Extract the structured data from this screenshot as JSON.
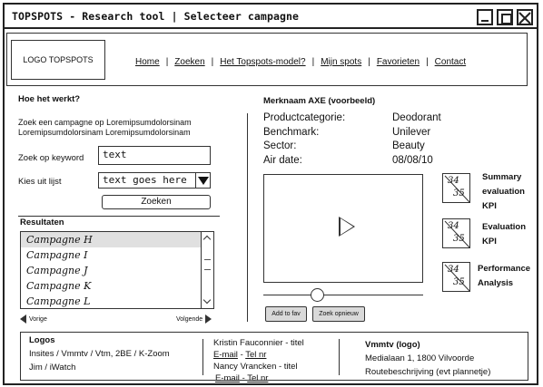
{
  "window": {
    "title": "TOPSPOTS - Research tool | Selecteer campagne"
  },
  "header": {
    "logo": "LOGO TOPSPOTS",
    "nav": [
      {
        "label": "Home"
      },
      {
        "label": "Zoeken"
      },
      {
        "label": "Het Topspots-model?"
      },
      {
        "label": "Mijn spots"
      },
      {
        "label": "Favorieten"
      },
      {
        "label": "Contact"
      }
    ]
  },
  "search": {
    "title": "Hoe het werkt?",
    "intro_line1": "Zoek een campagne op Loremipsumdolorsinam",
    "intro_line2": "Loremipsumdolorsinam Loremipsumdolorsinam",
    "keyword_label": "Zoek op keyword",
    "keyword_value": "text",
    "list_label": "Kies uit lijst",
    "list_value": "text goes here",
    "button_label": "Zoeken"
  },
  "results": {
    "title": "Resultaten",
    "items": [
      "Campagne H",
      "Campagne I",
      "Campagne J",
      "Campagne K",
      "Campagne L"
    ],
    "selected_index": 0,
    "prev_label": "Vorige",
    "next_label": "Volgende"
  },
  "detail": {
    "brand_title": "Merknaam AXE (voorbeeld)",
    "rows": [
      {
        "key": "Productcategorie:",
        "value": "Deodorant"
      },
      {
        "key": "Benchmark:",
        "value": "Unilever"
      },
      {
        "key": "Sector:",
        "value": "Beauty"
      },
      {
        "key": "Air date:",
        "value": "08/08/10"
      }
    ],
    "add_fav_label": "Add to fav",
    "zoek_opnieuw_label": "Zoek opnieuw",
    "video_progress": 0.34
  },
  "kpis": [
    {
      "top": "34",
      "bottom": "35",
      "label_lines": [
        "Summary",
        "evaluation",
        "KPI"
      ]
    },
    {
      "top": "34",
      "bottom": "35",
      "label_lines": [
        "Evaluation",
        "KPI"
      ]
    },
    {
      "top": "34",
      "bottom": "35",
      "label_lines": [
        "Performance",
        "Analysis"
      ]
    }
  ],
  "footer": {
    "logos_title": "Logos",
    "logos_line1": "Insites / Vmmtv / Vtm, 2BE / K-Zoom",
    "logos_line2": "Jim / iWatch",
    "contact1_name": "Kristin Fauconnier - titel",
    "contact2_name": "Nancy Vrancken - titel",
    "email_label": "E-mail",
    "tel_label": "Tel nr",
    "contact_separator": "-",
    "vmmtv_title": "Vmmtv (logo)",
    "vmmtv_address": "Medialaan 1, 1800 Vilvoorde",
    "vmmtv_route": "Routebeschrijving (evt plannetje)"
  }
}
